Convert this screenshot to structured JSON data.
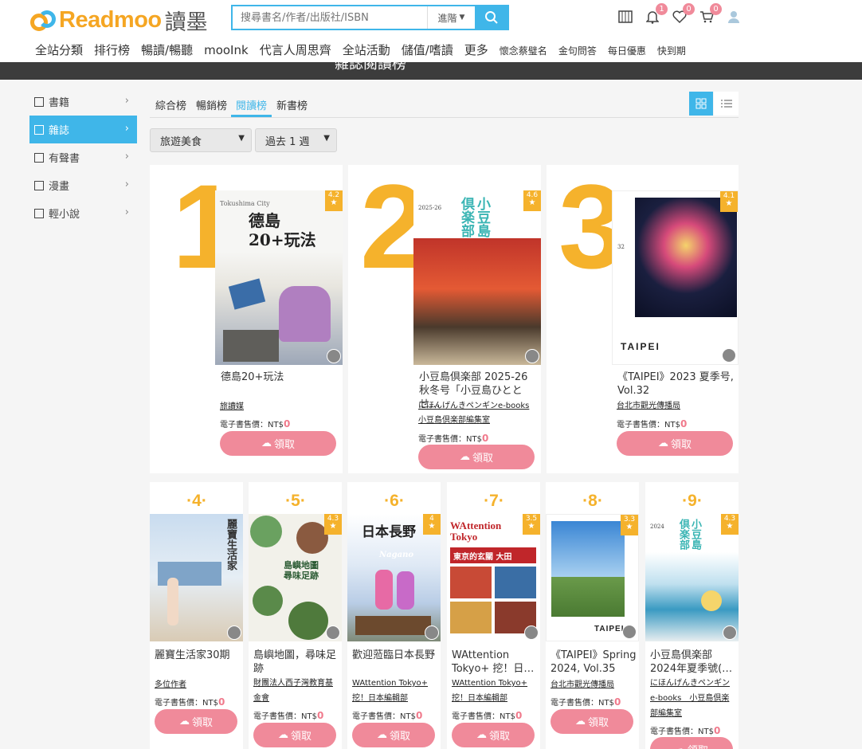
{
  "header": {
    "logo_en": "Readmoo",
    "logo_cn": "讀墨",
    "search_placeholder": "搜尋書名/作者/出版社/ISBN",
    "advanced_label": "進階",
    "badges": {
      "notifications": "1",
      "wishlist": "0",
      "cart": "0"
    },
    "icons": [
      "reader-icon",
      "bell-icon",
      "heart-icon",
      "cart-icon",
      "user-icon",
      "search-icon"
    ]
  },
  "nav": {
    "main": [
      "全站分類",
      "排行榜",
      "暢讀/暢聽",
      "mooInk",
      "代言人周思齊",
      "全站活動",
      "儲值/嗜讀",
      "更多"
    ],
    "minor": [
      "懷念蔡璧名",
      "金句問答",
      "每日優惠",
      "快到期"
    ]
  },
  "banner_title": "雜誌閱讀榜",
  "sidebar": {
    "items": [
      {
        "label": "書籍"
      },
      {
        "label": "雜誌"
      },
      {
        "label": "有聲書"
      },
      {
        "label": "漫畫"
      },
      {
        "label": "輕小說"
      }
    ],
    "active_index": 1
  },
  "tabs": [
    "綜合榜",
    "暢銷榜",
    "閱讀榜",
    "新書榜"
  ],
  "active_tab": "閱讀榜",
  "filters": {
    "category": "旅遊美食",
    "period": "過去 1 週"
  },
  "price_label": "電子書售價：NT$",
  "get_label": "領取",
  "colors": {
    "accent": "#3fb6e9",
    "rank_yellow": "#f5b22c",
    "button_pink": "#f08a9a",
    "price_pink": "#f07a8c"
  },
  "books": [
    {
      "rank": "1",
      "rating": "4.2",
      "title": "德島20+玩法",
      "author": "旅讀媒",
      "author2": "",
      "price": "0",
      "cover_text": "德島\n20+玩法",
      "cover_sub": "Tokushima City"
    },
    {
      "rank": "2",
      "rating": "4.6",
      "title": "小豆島倶楽部 2025-26 秋冬号「小豆島ひととせ…",
      "author": "にほんげんきペンギンe-books",
      "author2": "小豆島倶楽部編集室",
      "price": "0",
      "cover_text": "小豆島\n倶楽部",
      "cover_sub": "2025-26"
    },
    {
      "rank": "3",
      "rating": "4.1",
      "title": "《TAIPEI》2023 夏季号, Vol.32",
      "author": "台北市觀光傳播局",
      "author2": "",
      "price": "0",
      "cover_text": "TAIPEI",
      "cover_sub": "32"
    },
    {
      "rank": "4",
      "rating": "",
      "title": "麗寶生活家30期",
      "author": "多位作者",
      "author2": "",
      "price": "0",
      "cover_text": "麗寶生活家",
      "cover_sub": ""
    },
    {
      "rank": "5",
      "rating": "4.3",
      "title": "島嶼地圖，尋味足跡",
      "author": "財團法人西子灣教育基金會",
      "author2": "",
      "price": "0",
      "cover_text": "島嶼地圖\n尋味足跡",
      "cover_sub": ""
    },
    {
      "rank": "6",
      "rating": "4",
      "title": "歡迎蒞臨日本長野",
      "author": "WAttention Tokyo+",
      "author2": "挖！日本編輯部",
      "price": "0",
      "cover_text": "日本長野",
      "cover_sub": "Nagano"
    },
    {
      "rank": "7",
      "rating": "3.5",
      "title": "WAttention Tokyo+ 挖！日…",
      "author": "WAttention Tokyo+",
      "author2": "挖！日本編輯部",
      "price": "0",
      "cover_text": "WAttention\nTokyo",
      "cover_sub": "東京的玄關 大田"
    },
    {
      "rank": "8",
      "rating": "3.3",
      "title": "《TAIPEI》Spring 2024, Vol.35",
      "author": "台北市觀光傳播局",
      "author2": "",
      "price": "0",
      "cover_text": "TAIPEI",
      "cover_sub": ""
    },
    {
      "rank": "9",
      "rating": "4.3",
      "title": "小豆島倶楽部 2024年夏季號(…",
      "author": "にほんげんきペンギン",
      "author2": "e-books　小豆島倶楽部編集室",
      "price": "0",
      "cover_text": "小豆島\n倶楽部",
      "cover_sub": "2024"
    }
  ]
}
